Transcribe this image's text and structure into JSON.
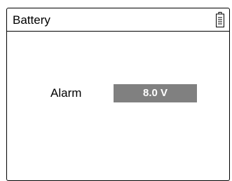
{
  "header": {
    "title": "Battery",
    "icon": "battery-icon"
  },
  "alarm": {
    "label": "Alarm",
    "value": "8.0 V",
    "field_color": "#808080",
    "text_color": "#ffffff"
  }
}
